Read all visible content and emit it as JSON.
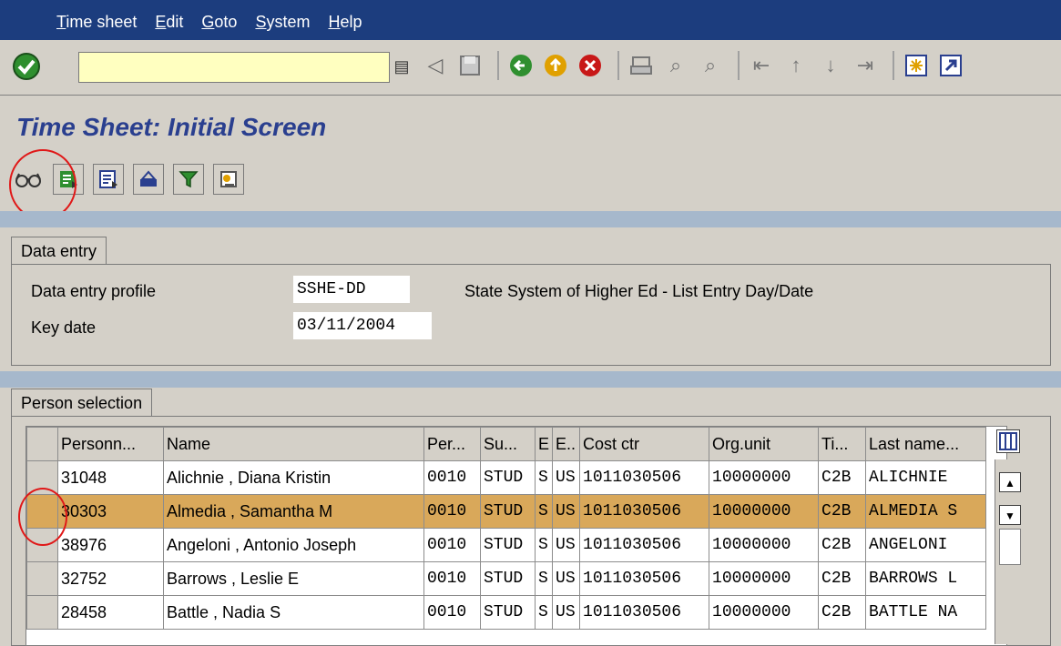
{
  "menu": {
    "items": [
      {
        "label": "Time sheet"
      },
      {
        "label": "Edit"
      },
      {
        "label": "Goto"
      },
      {
        "label": "System"
      },
      {
        "label": "Help"
      }
    ]
  },
  "toolbar": {
    "command_value": "",
    "icons": [
      "enter-icon",
      "back-icon",
      "save-icon",
      "nav-back-icon",
      "exit-icon",
      "cancel-icon",
      "print-icon",
      "find-icon",
      "find-next-icon",
      "first-page-icon",
      "prev-page-icon",
      "next-page-icon",
      "last-page-icon",
      "new-session-icon",
      "shortcut-icon"
    ]
  },
  "page": {
    "title": "Time Sheet: Initial Screen"
  },
  "data_entry": {
    "tab_label": "Data entry",
    "profile_label": "Data entry profile",
    "profile_value": "SSHE-DD",
    "profile_desc": "State System of Higher Ed - List Entry Day/Date",
    "keydate_label": "Key date",
    "keydate_value": "03/11/2004"
  },
  "person_selection": {
    "tab_label": "Person selection",
    "columns": [
      "Personn...",
      "Name",
      "Per...",
      "Su...",
      "E",
      "E..",
      "Cost ctr",
      "Org.unit",
      "Ti...",
      "Last name..."
    ],
    "rows": [
      [
        "31048",
        "Alichnie , Diana Kristin",
        "0010",
        "STUD",
        "S",
        "US",
        "1011030506",
        "10000000",
        "C2B",
        "ALICHNIE"
      ],
      [
        "30303",
        "Almedia , Samantha M",
        "0010",
        "STUD",
        "S",
        "US",
        "1011030506",
        "10000000",
        "C2B",
        "ALMEDIA S"
      ],
      [
        "38976",
        "Angeloni , Antonio Joseph",
        "0010",
        "STUD",
        "S",
        "US",
        "1011030506",
        "10000000",
        "C2B",
        "ANGELONI"
      ],
      [
        "32752",
        "Barrows , Leslie E",
        "0010",
        "STUD",
        "S",
        "US",
        "1011030506",
        "10000000",
        "C2B",
        "BARROWS L"
      ],
      [
        "28458",
        "Battle , Nadia S",
        "0010",
        "STUD",
        "S",
        "US",
        "1011030506",
        "10000000",
        "C2B",
        "BATTLE NA"
      ]
    ],
    "highlighted_row": 1
  }
}
